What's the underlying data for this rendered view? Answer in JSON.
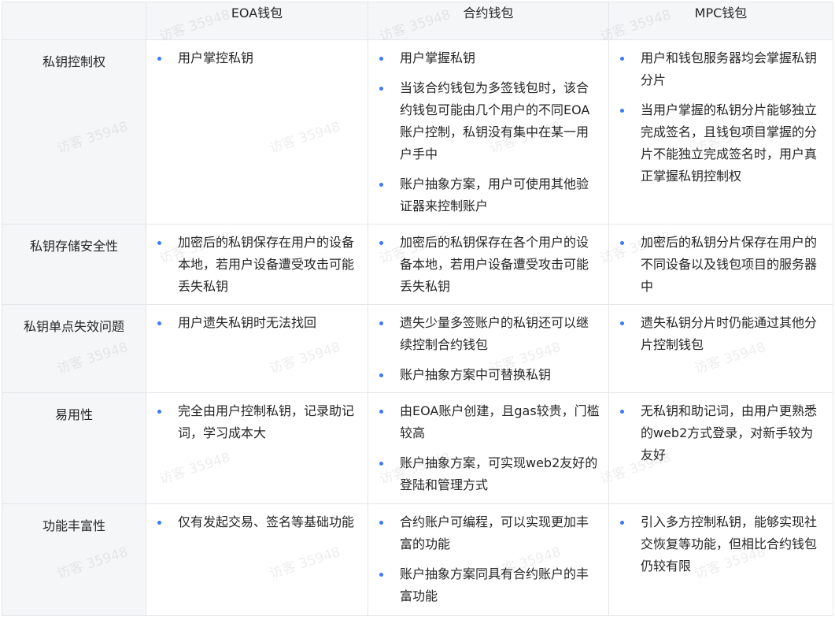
{
  "header": [
    "",
    "EOA钱包",
    "合约钱包",
    "MPC钱包"
  ],
  "rows": [
    {
      "label": "私钥控制权",
      "eoa": [
        "用户掌控私钥"
      ],
      "contract": [
        "用户掌握私钥",
        "当该合约钱包为多签钱包时，该合约钱包可能由几个用户的不同EOA账户控制，私钥没有集中在某一用户手中",
        "账户抽象方案，用户可使用其他验证器来控制账户"
      ],
      "mpc": [
        "用户和钱包服务器均会掌握私钥分片",
        "当用户掌握的私钥分片能够独立完成签名，且钱包项目掌握的分片不能独立完成签名时，用户真正掌握私钥控制权"
      ]
    },
    {
      "label": "私钥存储安全性",
      "eoa": [
        "加密后的私钥保存在用户的设备本地，若用户设备遭受攻击可能丢失私钥"
      ],
      "contract": [
        "加密后的私钥保存在各个用户的设备本地，若用户设备遭受攻击可能丢失私钥"
      ],
      "mpc": [
        "加密后的私钥分片保存在用户的不同设备以及钱包项目的服务器中"
      ]
    },
    {
      "label": "私钥单点失效问题",
      "eoa": [
        "用户遗失私钥时无法找回"
      ],
      "contract": [
        "遗失少量多签账户的私钥还可以继续控制合约钱包",
        "账户抽象方案中可替换私钥"
      ],
      "mpc": [
        "遗失私钥分片时仍能通过其他分片控制钱包"
      ]
    },
    {
      "label": "易用性",
      "eoa": [
        "完全由用户控制私钥，记录助记词，学习成本大"
      ],
      "contract": [
        "由EOA账户创建，且gas较贵，门槛较高",
        "账户抽象方案，可实现web2友好的登陆和管理方式"
      ],
      "mpc": [
        "无私钥和助记词，由用户更熟悉的web2方式登录，对新手较为友好"
      ]
    },
    {
      "label": "功能丰富性",
      "eoa": [
        "仅有发起交易、签名等基础功能"
      ],
      "contract": [
        "合约账户可编程，可以实现更加丰富的功能",
        "账户抽象方案同具有合约账户的丰富功能"
      ],
      "mpc": [
        "引入多方控制私钥，能够实现社交恢复等功能，但相比合约钱包仍较有限"
      ]
    }
  ],
  "watermark": "访客 35948",
  "colors": {
    "bullet": "#3a7afe",
    "header_bg": "#f5f6f8",
    "border": "#e4e6ea",
    "text": "#262626"
  }
}
